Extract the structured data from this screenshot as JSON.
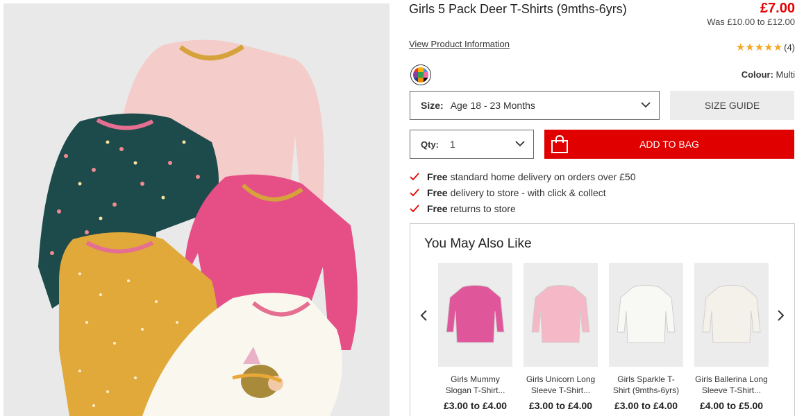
{
  "product": {
    "title": "Girls 5 Pack Deer T-Shirts (9mths-6yrs)",
    "price": "£7.00",
    "was_price": "Was £10.00 to £12.00",
    "view_info_label": "View Product Information",
    "review_count": "(4)",
    "rating": 5,
    "stars": "★★★★★",
    "image_icon": "five-pack-tshirts-photo"
  },
  "colour": {
    "label": "Colour:",
    "value": "Multi",
    "swatch_colors": [
      "#e8322d",
      "#ffb000",
      "#5a8fd8",
      "#8e3ca3",
      "#31a24c",
      "#f26aa8",
      "#1d3f8f",
      "#f08c00",
      "#111111"
    ]
  },
  "size": {
    "label": "Size:",
    "value": "Age 18 - 23 Months",
    "guide_label": "SIZE GUIDE"
  },
  "qty": {
    "label": "Qty:",
    "value": "1"
  },
  "add_to_bag": {
    "label": "ADD TO BAG",
    "color": "#e00000"
  },
  "delivery": [
    {
      "bold": "Free",
      "text": "standard home delivery on orders over £50"
    },
    {
      "bold": "Free",
      "text": "delivery to store - with click & collect"
    },
    {
      "bold": "Free",
      "text": "returns to store"
    }
  ],
  "recommendations": {
    "heading": "You May Also Like",
    "items": [
      {
        "name": "Girls Mummy Slogan T-Shirt...",
        "price": "£3.00 to £4.00",
        "shirt_color": "#e0569a"
      },
      {
        "name": "Girls Unicorn Long Sleeve T-Shirt...",
        "price": "£3.00 to £4.00",
        "shirt_color": "#f4b8c6"
      },
      {
        "name": "Girls Sparkle T-Shirt (9mths-6yrs)",
        "price": "£3.00 to £4.00",
        "shirt_color": "#f8f8f4"
      },
      {
        "name": "Girls Ballerina Long Sleeve T-Shirt...",
        "price": "£4.00 to £5.00",
        "shirt_color": "#f4f1ea"
      }
    ]
  }
}
